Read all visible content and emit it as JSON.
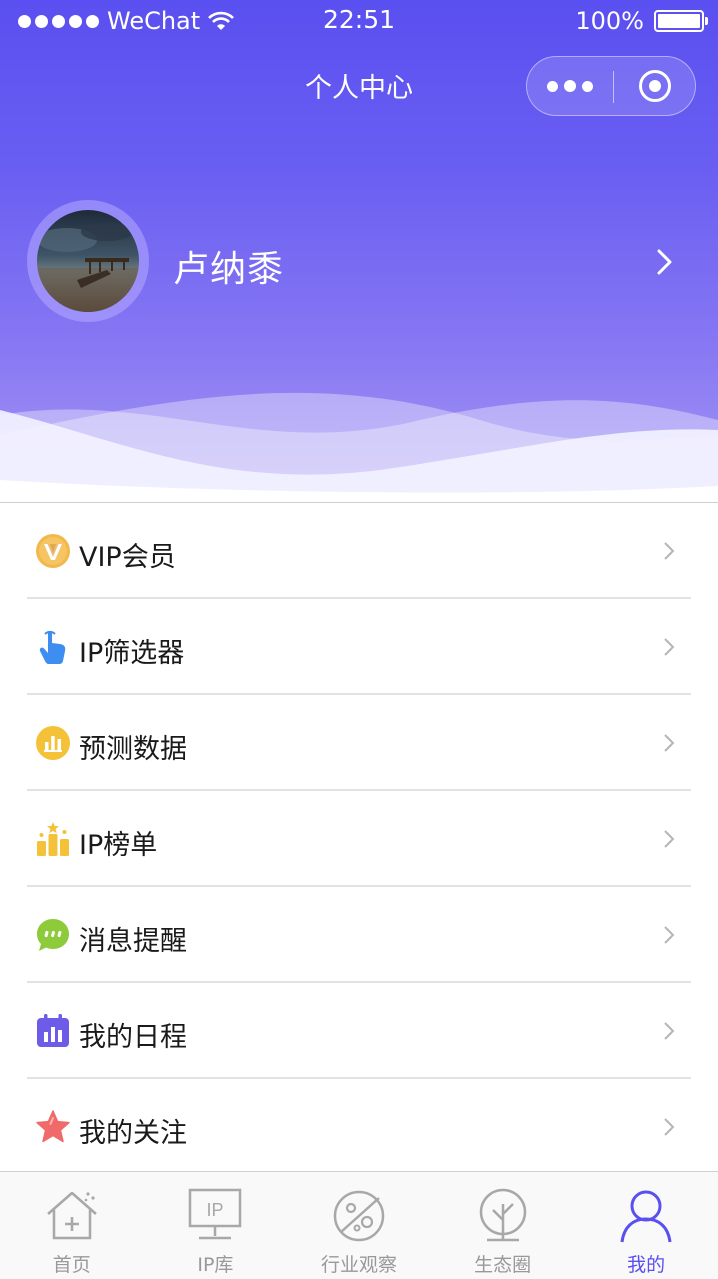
{
  "status_bar": {
    "carrier": "WeChat",
    "time": "22:51",
    "battery": "100%"
  },
  "nav": {
    "title": "个人中心"
  },
  "profile": {
    "name": "卢纳黍"
  },
  "menu": [
    {
      "label": "VIP会员",
      "icon": "vip-icon"
    },
    {
      "label": "IP筛选器",
      "icon": "pointer-hand-icon"
    },
    {
      "label": "预测数据",
      "icon": "forecast-chart-icon"
    },
    {
      "label": "IP榜单",
      "icon": "ranking-icon"
    },
    {
      "label": "消息提醒",
      "icon": "message-icon"
    },
    {
      "label": "我的日程",
      "icon": "calendar-icon"
    },
    {
      "label": "我的关注",
      "icon": "star-icon"
    }
  ],
  "tabbar": {
    "tabs": [
      {
        "label": "首页",
        "icon": "home-icon",
        "active": false
      },
      {
        "label": "IP库",
        "icon": "ip-library-icon",
        "active": false
      },
      {
        "label": "行业观察",
        "icon": "planet-icon",
        "active": false
      },
      {
        "label": "生态圈",
        "icon": "tree-icon",
        "active": false
      },
      {
        "label": "我的",
        "icon": "user-icon",
        "active": true
      }
    ]
  },
  "colors": {
    "accent": "#5a4ff0",
    "tab_inactive": "#999999"
  }
}
